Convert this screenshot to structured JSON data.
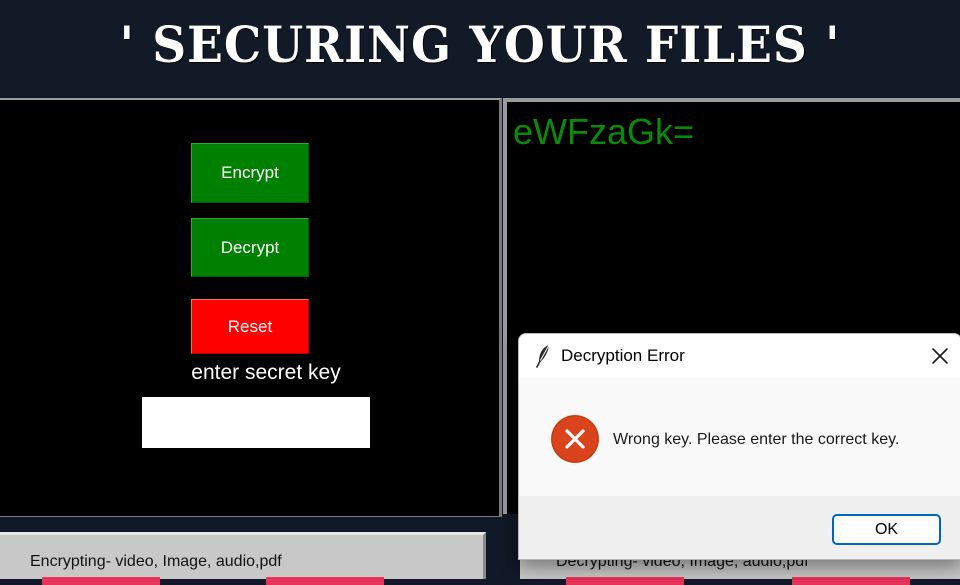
{
  "app": {
    "title": "' SECURING YOUR FILES '"
  },
  "left_panel": {
    "encrypt_label": "Encrypt",
    "decrypt_label": "Decrypt",
    "reset_label": "Reset",
    "key_label": "enter secret key",
    "key_value": ""
  },
  "right_panel": {
    "output_text": "eWFzaGk="
  },
  "bottom": {
    "encrypt_section_label": "Encrypting- video, Image, audio,pdf",
    "decrypt_section_label": "Decrypting- video, Image, audio,pdf"
  },
  "dialog": {
    "title": "Decryption Error",
    "message": "Wrong key. Please enter the correct key.",
    "ok_label": "OK",
    "icons": {
      "app": "feather-icon",
      "close": "close-icon",
      "status": "error-icon"
    }
  },
  "colors": {
    "green_button": "#008000",
    "red_button": "#ff0000",
    "output_text": "#0a8a0a",
    "error_icon": "#d9441c",
    "ok_border": "#0067c0",
    "header_bg": "#121a28"
  }
}
